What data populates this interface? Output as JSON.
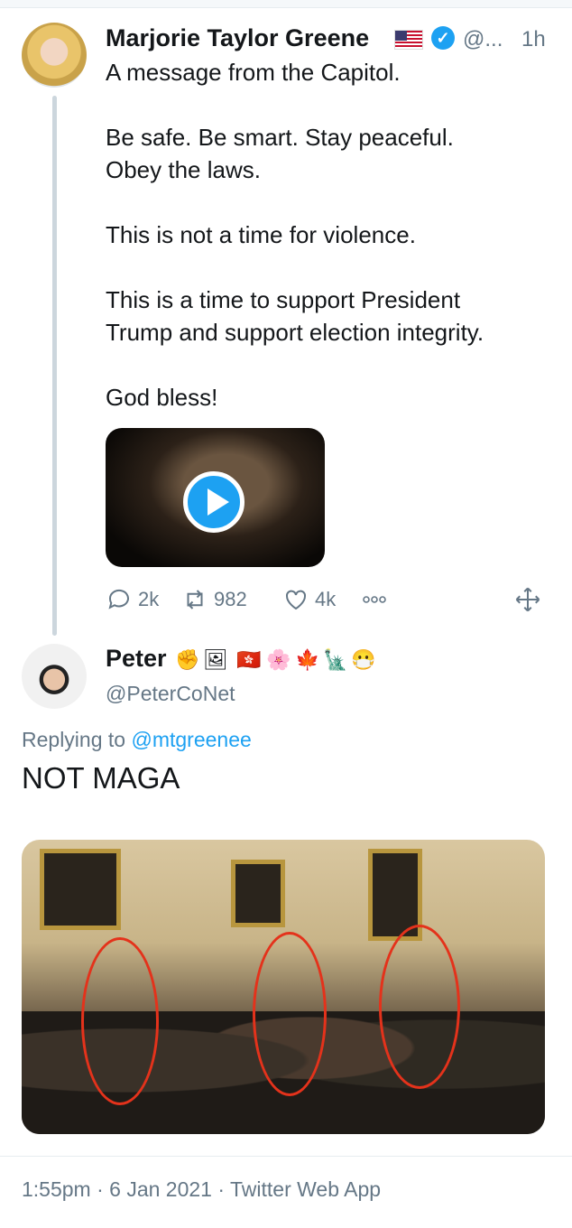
{
  "tweet": {
    "author_name": "Marjorie Taylor Greene",
    "flag_icon": "us-flag-icon",
    "handle": "@...",
    "time": "1h",
    "lines": [
      "A message from the Capitol.",
      "Be safe. Be smart. Stay peaceful.",
      "Obey the laws.",
      "This is not a time for violence.",
      "This is a time to support President",
      "Trump and support election integrity.",
      "God bless!"
    ],
    "stats": {
      "replies": "2k",
      "retweets": "982",
      "likes": "4k"
    }
  },
  "reply": {
    "author_name": "Peter",
    "handle": "@PeterCoNet",
    "replying_label": "Replying to",
    "replying_handle": "@mtgreenee",
    "text": "NOT MAGA",
    "emojis": [
      "✊",
      "🖼",
      "🇭🇰",
      "🌸",
      "🍁",
      "🗽",
      "😷"
    ]
  },
  "footer": {
    "meta": "1:55pm · 6 Jan 2021 · Twitter Web App"
  },
  "colors": {
    "accent": "#1da1f2",
    "secondary_text": "#657786",
    "annotation_red": "#e4321b"
  }
}
